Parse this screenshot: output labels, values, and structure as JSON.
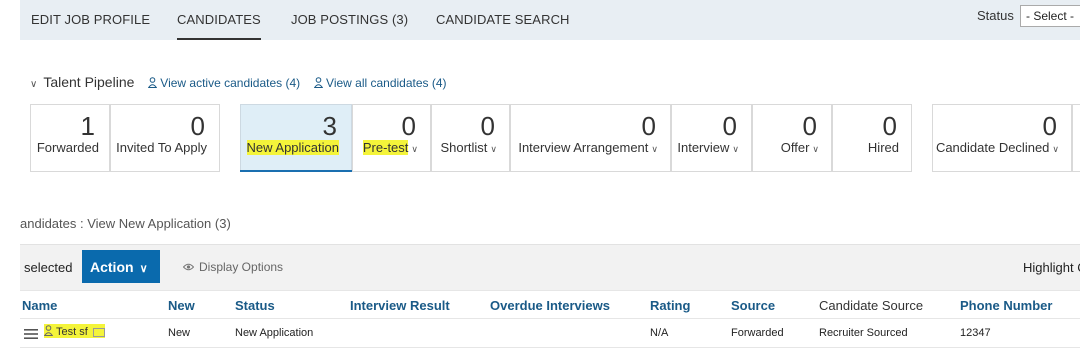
{
  "tabs": [
    {
      "label": "EDIT JOB PROFILE"
    },
    {
      "label": "CANDIDATES"
    },
    {
      "label": "JOB POSTINGS (3)"
    },
    {
      "label": "CANDIDATE SEARCH"
    }
  ],
  "status": {
    "label": "Status",
    "value": "- Select -"
  },
  "pipeline": {
    "title": "Talent Pipeline",
    "active_link": "View active candidates (4)",
    "all_link": "View all candidates (4)",
    "stages": [
      {
        "count": "1",
        "label": "Forwarded"
      },
      {
        "count": "0",
        "label": "Invited To Apply"
      },
      {
        "count": "3",
        "label": "New Application"
      },
      {
        "count": "0",
        "label": "Pre-test"
      },
      {
        "count": "0",
        "label": "Shortlist"
      },
      {
        "count": "0",
        "label": "Interview Arrangement"
      },
      {
        "count": "0",
        "label": "Interview"
      },
      {
        "count": "0",
        "label": "Offer"
      },
      {
        "count": "0",
        "label": "Hired"
      },
      {
        "count": "0",
        "label": "Candidate Declined"
      }
    ]
  },
  "view_title": "andidates : View New Application (3)",
  "actionbar": {
    "selected": "selected",
    "action": "Action",
    "display_options": "Display Options",
    "highlight": "Highlight C"
  },
  "table": {
    "columns": [
      "Name",
      "New",
      "Status",
      "Interview Result",
      "Overdue Interviews",
      "Rating",
      "Source",
      "Candidate Source",
      "Phone Number"
    ],
    "rows": [
      {
        "name": "Test sf",
        "new": "New",
        "status": "New Application",
        "interview_result": "",
        "overdue": "",
        "rating": "N/A",
        "source": "Forwarded",
        "candidate_source": "Recruiter Sourced",
        "phone": "12347"
      }
    ]
  },
  "colors": {
    "accent": "#0a6aad",
    "link": "#1a5a87",
    "highlight": "#f4f43a",
    "tabbar": "#e8eef3"
  }
}
